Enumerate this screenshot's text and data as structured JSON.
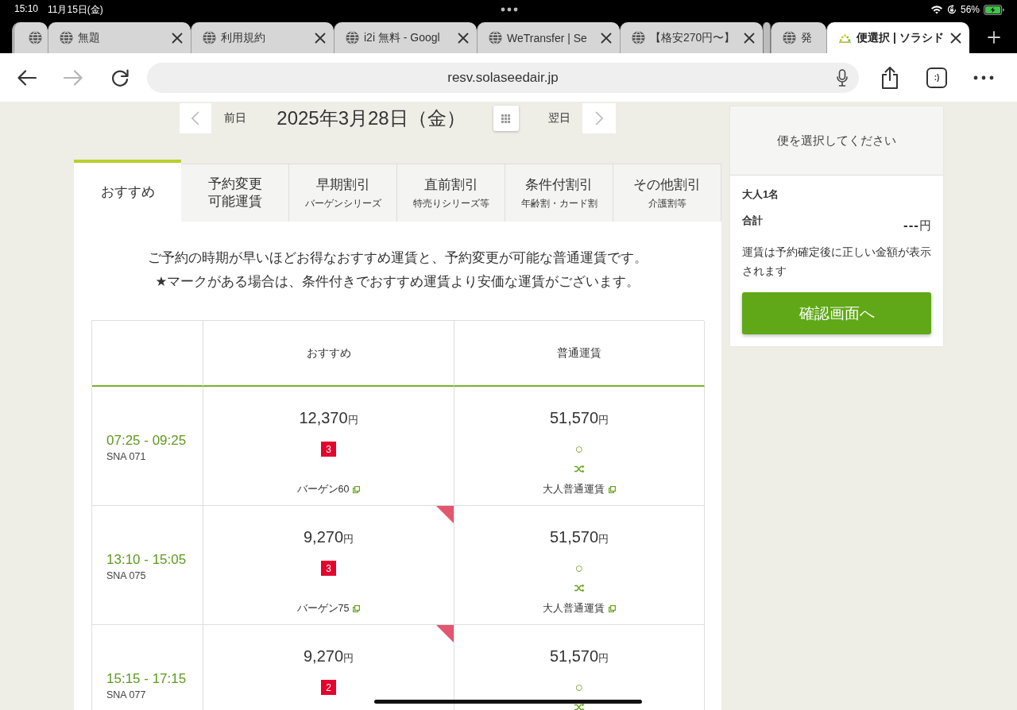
{
  "status_bar": {
    "time": "15:10",
    "date": "11月15日(金)",
    "battery": "56%"
  },
  "browser": {
    "tabs": [
      {
        "kind": "stacked",
        "selected": false
      },
      {
        "kind": "page",
        "title": "無題",
        "selected": false
      },
      {
        "kind": "page",
        "title": "利用規約",
        "selected": false
      },
      {
        "kind": "page",
        "title": "i2i 無料 - Googl",
        "selected": false
      },
      {
        "kind": "page",
        "title": "WeTransfer | Se",
        "selected": false
      },
      {
        "kind": "page",
        "title": "【格安270円〜】",
        "selected": false
      },
      {
        "kind": "narrow",
        "title": "発",
        "selected": false
      },
      {
        "kind": "page",
        "title": "便選択 | ソラシド",
        "selected": true
      }
    ],
    "url": "resv.solaseedair.jp",
    "forward_enabled": false,
    "tab_switcher": ":)"
  },
  "date_nav": {
    "previous": "前日",
    "date": "2025年3月28日（金）",
    "next": "翌日"
  },
  "fare_tabs": [
    {
      "title": "おすすめ",
      "selected": true
    },
    {
      "title": "予約変更可能運賃",
      "selected": false
    },
    {
      "title": "早期割引",
      "subtitle": "バーゲンシリーズ",
      "selected": false
    },
    {
      "title": "直前割引",
      "subtitle": "特売りシリーズ等",
      "selected": false
    },
    {
      "title": "条件付割引",
      "subtitle": "年齢割・カード割",
      "selected": false
    },
    {
      "title": "その他割引",
      "subtitle": "介護割等",
      "selected": false
    }
  ],
  "description": [
    "ご予約の時期が早いほどお得なおすすめ運賃と、予約変更が可能な普通運賃です。",
    "★マークがある場合は、条件付きでおすすめ運賃より安価な運賃がございます。"
  ],
  "fare_table": {
    "columns": [
      "おすすめ",
      "普通運賃"
    ],
    "rows": [
      {
        "time": "07:25 - 09:25",
        "flight": "SNA 071",
        "fares": [
          {
            "kind": "discount",
            "price": "12,370",
            "currency": "円",
            "seats": "3",
            "name": "バーゲン60",
            "corner_mark": false
          },
          {
            "kind": "normal",
            "price": "51,570",
            "currency": "円",
            "availability": "○",
            "changeable": true,
            "name": "大人普通運賃"
          }
        ]
      },
      {
        "time": "13:10 - 15:05",
        "flight": "SNA 075",
        "fares": [
          {
            "kind": "discount",
            "price": "9,270",
            "currency": "円",
            "seats": "3",
            "name": "バーゲン75",
            "corner_mark": true
          },
          {
            "kind": "normal",
            "price": "51,570",
            "currency": "円",
            "availability": "○",
            "changeable": true,
            "name": "大人普通運賃"
          }
        ]
      },
      {
        "time": "15:15 - 17:15",
        "flight": "SNA 077",
        "fares": [
          {
            "kind": "discount",
            "price": "9,270",
            "currency": "円",
            "seats": "2",
            "corner_mark": true
          },
          {
            "kind": "normal",
            "price": "51,570",
            "currency": "円",
            "availability": "○",
            "changeable": true
          }
        ]
      }
    ]
  },
  "summary": {
    "prompt": "便を選択してください",
    "passengers": "大人1名",
    "total_label": "合計",
    "total_value": "---",
    "total_currency": "円",
    "note": "運賃は予約確定後に正しい金額が表示されます",
    "button": "確認画面へ"
  }
}
